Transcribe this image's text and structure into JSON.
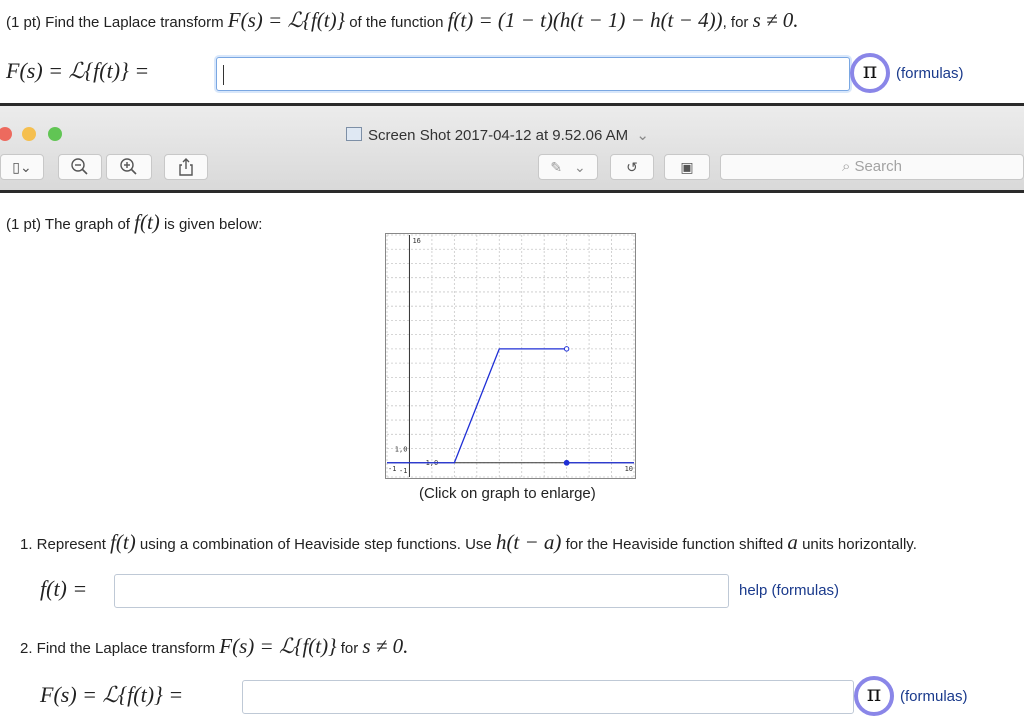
{
  "top_problem": {
    "pts": "(1 pt) Find the Laplace transform",
    "Fs_expr": "F(s) = ℒ{f(t)}",
    "of_fn": "of the function",
    "ft_expr": "f(t) = (1 − t)(h(t − 1) − h(t − 4))",
    "for_text": ", for",
    "cond": "s ≠ 0.",
    "answer_label": "F(s) = ℒ{f(t)} =",
    "answer_value": "",
    "pi_symbol": "π",
    "formulas_link": "(formulas)"
  },
  "viewer": {
    "window_title": "Screen Shot 2017-04-12 at 9.52.06 AM",
    "title_chevron": "⌄",
    "sidebar_toggle": "▯⌄",
    "zoom_out": "−",
    "zoom_in": "+",
    "share": "⇪",
    "markup": "✎",
    "markup_chevron": "⌄",
    "rotate": "↺",
    "toolbox": "▣",
    "search_placeholder": "Search",
    "search_icon": "⌕",
    "traffic_colors": [
      "#ed6a5e",
      "#f5bf4f",
      "#61c554"
    ]
  },
  "problem2": {
    "intro_pre": "(1 pt) The graph of",
    "intro_fn": "f(t)",
    "intro_post": "is given below:",
    "graph_caption": "(Click on graph to enlarge)",
    "q1_pre": "1. Represent",
    "q1_fn": "f(t)",
    "q1_mid": "using a combination of Heaviside step functions. Use",
    "q1_h": "h(t − a)",
    "q1_post": "for the Heaviside function shifted",
    "q1_a": "a",
    "q1_end": "units horizontally.",
    "ans1_label": "f(t) =",
    "ans1_value": "",
    "help_link": "help (formulas)",
    "q2_pre": "2. Find the Laplace transform",
    "q2_expr": "F(s) = ℒ{f(t)}",
    "q2_for": "for",
    "q2_cond": "s ≠ 0.",
    "ans2_label": "F(s) = ℒ{f(t)} =",
    "ans2_value": "",
    "pi_symbol": "π",
    "formulas_link": "(formulas)"
  },
  "chart_data": {
    "type": "line",
    "xlim": [
      -1,
      10
    ],
    "ylim": [
      -1,
      16
    ],
    "grid": true,
    "tick_labels": {
      "y_top": "16",
      "y_one": "1,0",
      "x_left": "-1",
      "x_origin": "-1",
      "x_one": "1,0",
      "x_right": "10"
    },
    "series": [
      {
        "points": [
          [
            -1,
            0
          ],
          [
            2,
            0
          ],
          [
            4,
            8
          ],
          [
            7,
            8
          ]
        ],
        "end": "open"
      },
      {
        "points": [
          [
            7,
            0
          ],
          [
            10,
            0
          ]
        ],
        "start": "closed"
      }
    ]
  }
}
